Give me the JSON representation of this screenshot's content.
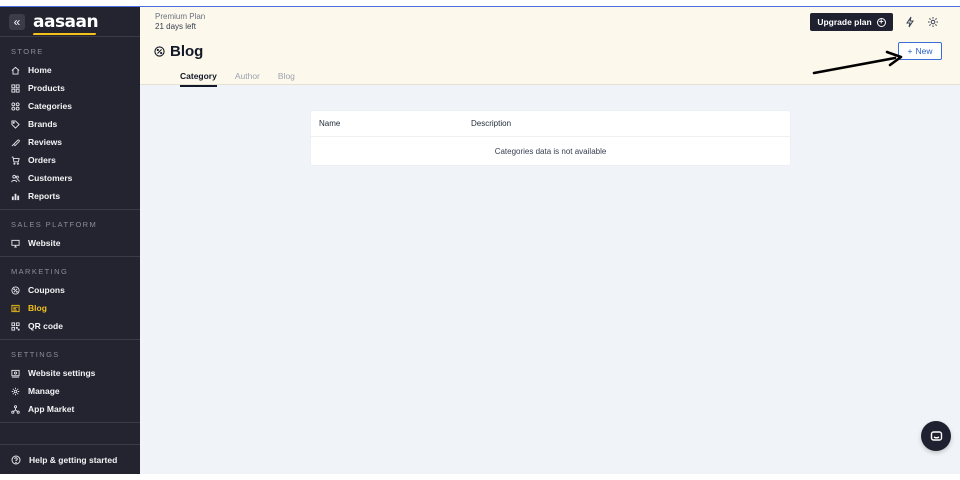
{
  "sidebar": {
    "logo": "aasaan",
    "collapse_icon": "«",
    "sections": {
      "store": {
        "title": "STORE",
        "items": [
          {
            "label": "Home",
            "icon": "home-icon"
          },
          {
            "label": "Products",
            "icon": "products-icon"
          },
          {
            "label": "Categories",
            "icon": "categories-icon"
          },
          {
            "label": "Brands",
            "icon": "tag-icon"
          },
          {
            "label": "Reviews",
            "icon": "reviews-icon"
          },
          {
            "label": "Orders",
            "icon": "cart-icon"
          },
          {
            "label": "Customers",
            "icon": "customers-icon"
          },
          {
            "label": "Reports",
            "icon": "reports-icon"
          }
        ]
      },
      "sales": {
        "title": "SALES PLATFORM",
        "items": [
          {
            "label": "Website",
            "icon": "monitor-icon"
          }
        ]
      },
      "marketing": {
        "title": "MARKETING",
        "items": [
          {
            "label": "Coupons",
            "icon": "coupon-icon"
          },
          {
            "label": "Blog",
            "icon": "blog-icon",
            "active": true
          },
          {
            "label": "QR code",
            "icon": "qr-icon"
          }
        ]
      },
      "settings": {
        "title": "SETTINGS",
        "items": [
          {
            "label": "Website settings",
            "icon": "website-settings-icon"
          },
          {
            "label": "Manage",
            "icon": "gear-icon"
          },
          {
            "label": "App Market",
            "icon": "app-market-icon"
          }
        ]
      }
    },
    "help": {
      "label": "Help & getting started",
      "icon": "help-icon"
    }
  },
  "header": {
    "plan_name": "Premium Plan",
    "plan_days": "21 days left",
    "upgrade_label": "Upgrade plan",
    "page_title": "Blog",
    "new_label": "New",
    "tabs": [
      {
        "label": "Category",
        "active": true
      },
      {
        "label": "Author",
        "active": false
      },
      {
        "label": "Blog",
        "active": false
      }
    ]
  },
  "table": {
    "columns": [
      "Name",
      "Description"
    ],
    "empty_message": "Categories data is not available"
  },
  "colors": {
    "sidebar_bg": "#23242f",
    "active_accent": "#f4c21a",
    "header_bg": "#fdf8ec",
    "primary_blue": "#2b5fc9",
    "dark_button": "#1f2130"
  }
}
